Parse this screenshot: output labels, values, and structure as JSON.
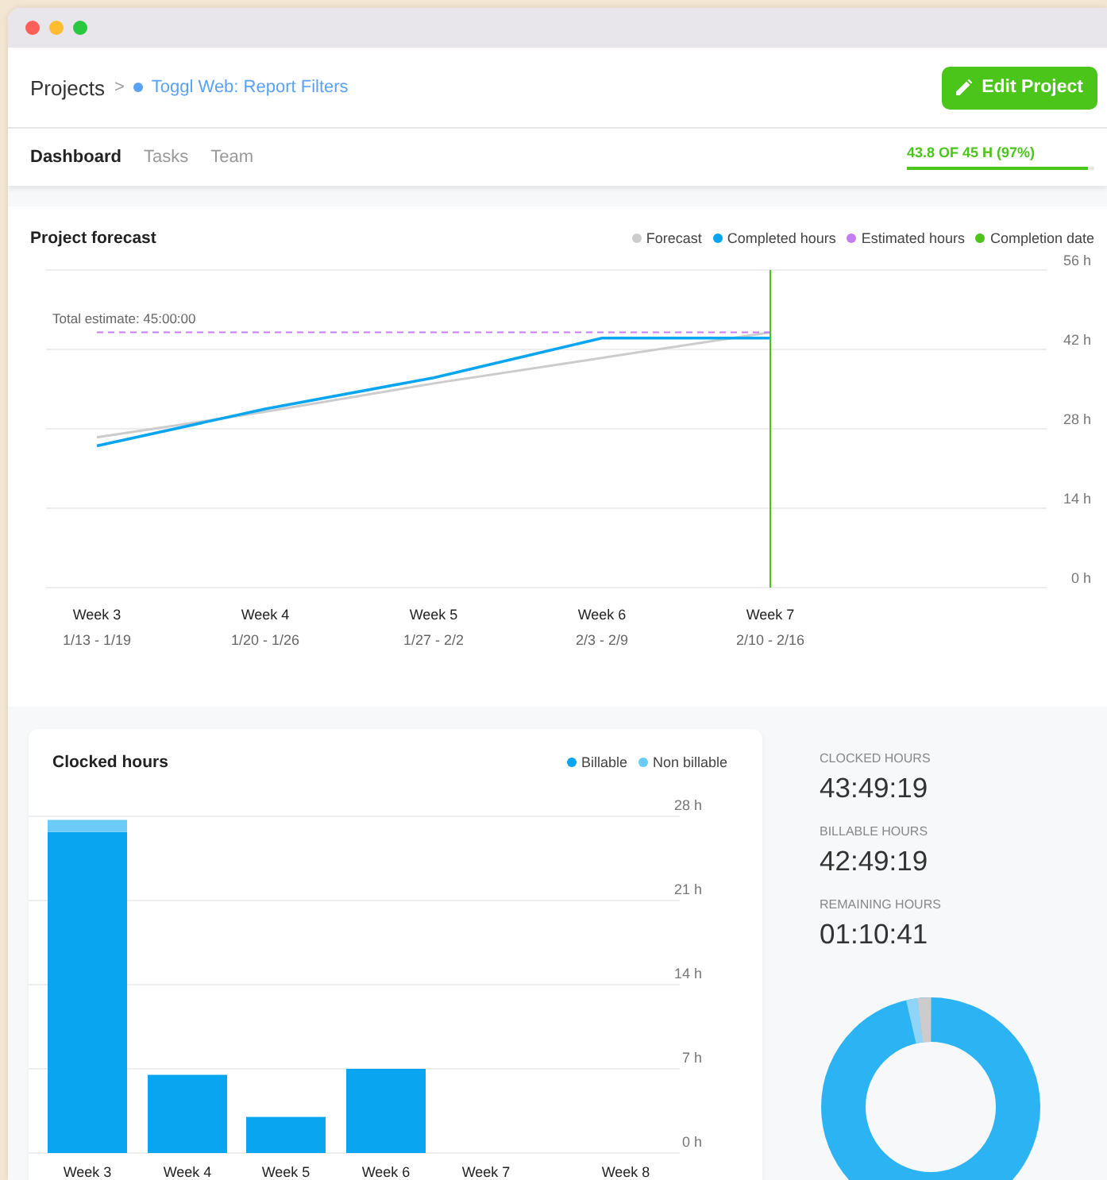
{
  "breadcrumb": {
    "parent": "Projects",
    "separator": ">",
    "project": "Toggl Web: Report Filters"
  },
  "edit_button": {
    "label": "Edit Project"
  },
  "tabs": [
    {
      "label": "Dashboard",
      "selected": true
    },
    {
      "label": "Tasks",
      "selected": false
    },
    {
      "label": "Team",
      "selected": false
    }
  ],
  "progress": {
    "label": "43.8 OF 45 H (97%)",
    "level": 0.97
  },
  "forecast": {
    "title": "Project forecast",
    "sublabels": [
      "1/13 - 1/19",
      "1/20 - 1/26",
      "1/27 - 2/2",
      "2/3 - 2/9",
      "2/10 - 2/16"
    ],
    "chart_data": {
      "type": "line",
      "categories": [
        "Week 3",
        "Week 4",
        "Week 5",
        "Week 6",
        "Week 7"
      ],
      "series": [
        {
          "name": "Forecast",
          "color": "#cccccc",
          "values": [
            26.5,
            31,
            36,
            40.5,
            45
          ]
        },
        {
          "name": "Completed hours",
          "color": "#0aa5f0",
          "values": [
            25,
            31.5,
            37,
            44,
            44
          ]
        },
        {
          "name": "Estimated hours",
          "color": "#c57cf2",
          "values": [
            45,
            45,
            45,
            45,
            45
          ],
          "line_style": "dashed"
        }
      ],
      "ref_lines": [
        {
          "axis": "x",
          "value": "Week 7",
          "label": "Completion date",
          "color": "#4cc31b"
        }
      ],
      "grid": true,
      "ylim": [
        0,
        56
      ],
      "yticks": [
        {
          "value": 0,
          "label": "0 h"
        },
        {
          "value": 14,
          "label": "14 h"
        },
        {
          "value": 28,
          "label": "28 h"
        },
        {
          "value": 42,
          "label": "42 h"
        },
        {
          "value": 56,
          "label": "56 h"
        }
      ],
      "annotations": [
        {
          "text": "Total estimate: 45:00:00",
          "y": 45
        }
      ]
    }
  },
  "clocked": {
    "title": "Clocked hours",
    "chart_data": {
      "type": "bar",
      "stacked": true,
      "categories": [
        "Week 3",
        "Week 4",
        "Week 5",
        "Week 6",
        "Week 7",
        "Week 8"
      ],
      "series": [
        {
          "name": "Billable",
          "color": "#0aa5f0",
          "values": [
            26.7,
            6.5,
            3,
            7,
            0,
            0
          ]
        },
        {
          "name": "Non billable",
          "color": "#6ccaf7",
          "values": [
            1,
            0,
            0,
            0,
            0,
            0
          ]
        }
      ],
      "grid": true,
      "ylim": [
        0,
        28
      ],
      "yticks": [
        {
          "value": 0,
          "label": "0 h"
        },
        {
          "value": 7,
          "label": "7 h"
        },
        {
          "value": 14,
          "label": "14 h"
        },
        {
          "value": 21,
          "label": "21 h"
        },
        {
          "value": 28,
          "label": "28 h"
        }
      ]
    }
  },
  "stats": [
    {
      "label": "CLOCKED HOURS",
      "value": "43:49:19"
    },
    {
      "label": "BILLABLE HOURS",
      "value": "42:49:19"
    },
    {
      "label": "REMAINING HOURS",
      "value": "01:10:41"
    }
  ]
}
